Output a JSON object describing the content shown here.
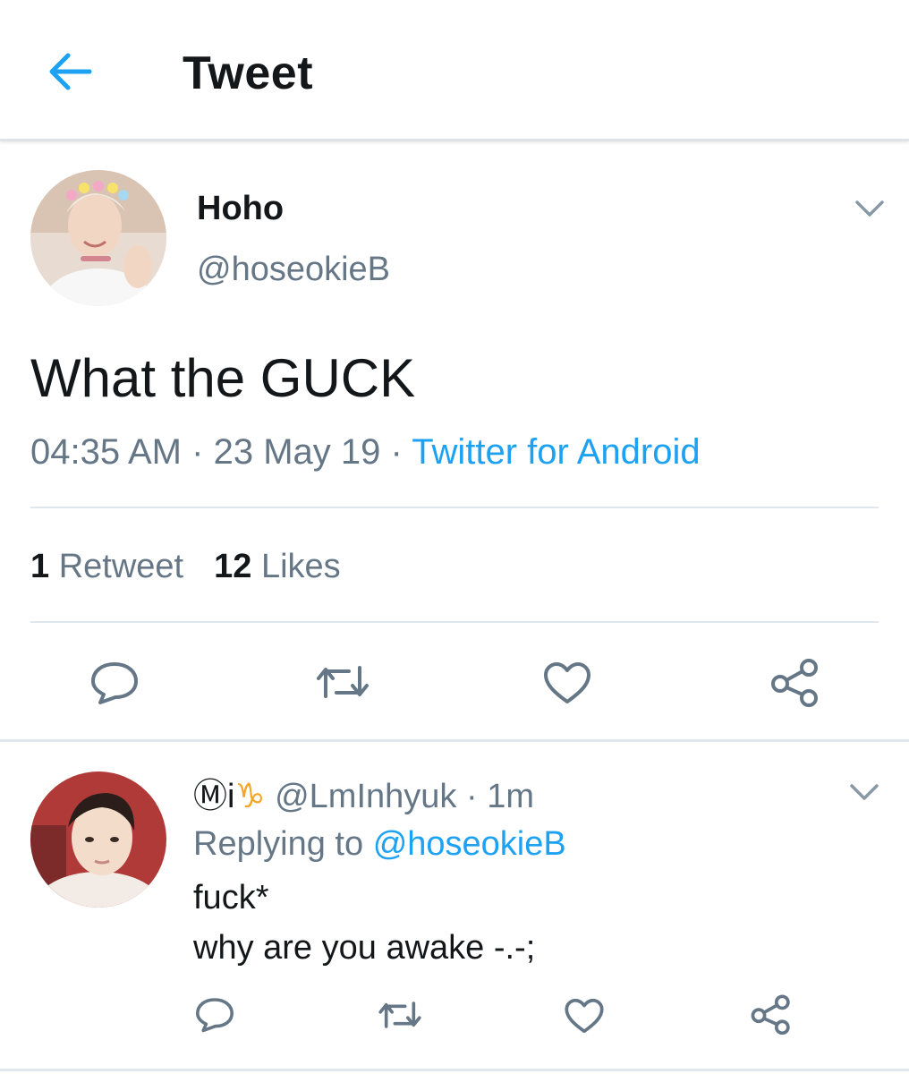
{
  "header": {
    "title": "Tweet",
    "back_icon": "arrow-left-icon",
    "accent": "#1da1f2"
  },
  "tweet": {
    "author_name": "Hoho",
    "author_handle": "@hoseokieB",
    "text": "What the GUCK",
    "time": "04:35 AM",
    "date": "23 May 19",
    "separator": "·",
    "source": "Twitter for Android",
    "retweet_count": "1",
    "retweet_label": "Retweet",
    "like_count": "12",
    "like_label": "Likes",
    "actions": [
      "reply-icon",
      "retweet-icon",
      "heart-icon",
      "share-icon"
    ]
  },
  "reply": {
    "name_prefix": "Ⓜi",
    "name_symbol": "♑",
    "handle": "@LmInhyuk",
    "separator": "·",
    "time": "1m",
    "replying_to_label": "Replying to",
    "replying_to_handle": "@hoseokieB",
    "text_line1": "fuck*",
    "text_line2": "why are you awake -.-;",
    "actions": [
      "reply-icon",
      "retweet-icon",
      "heart-icon",
      "share-icon"
    ]
  },
  "colors": {
    "text": "#14171a",
    "secondary": "#657786",
    "link": "#1da1f2",
    "divider": "#e1e8ed"
  }
}
